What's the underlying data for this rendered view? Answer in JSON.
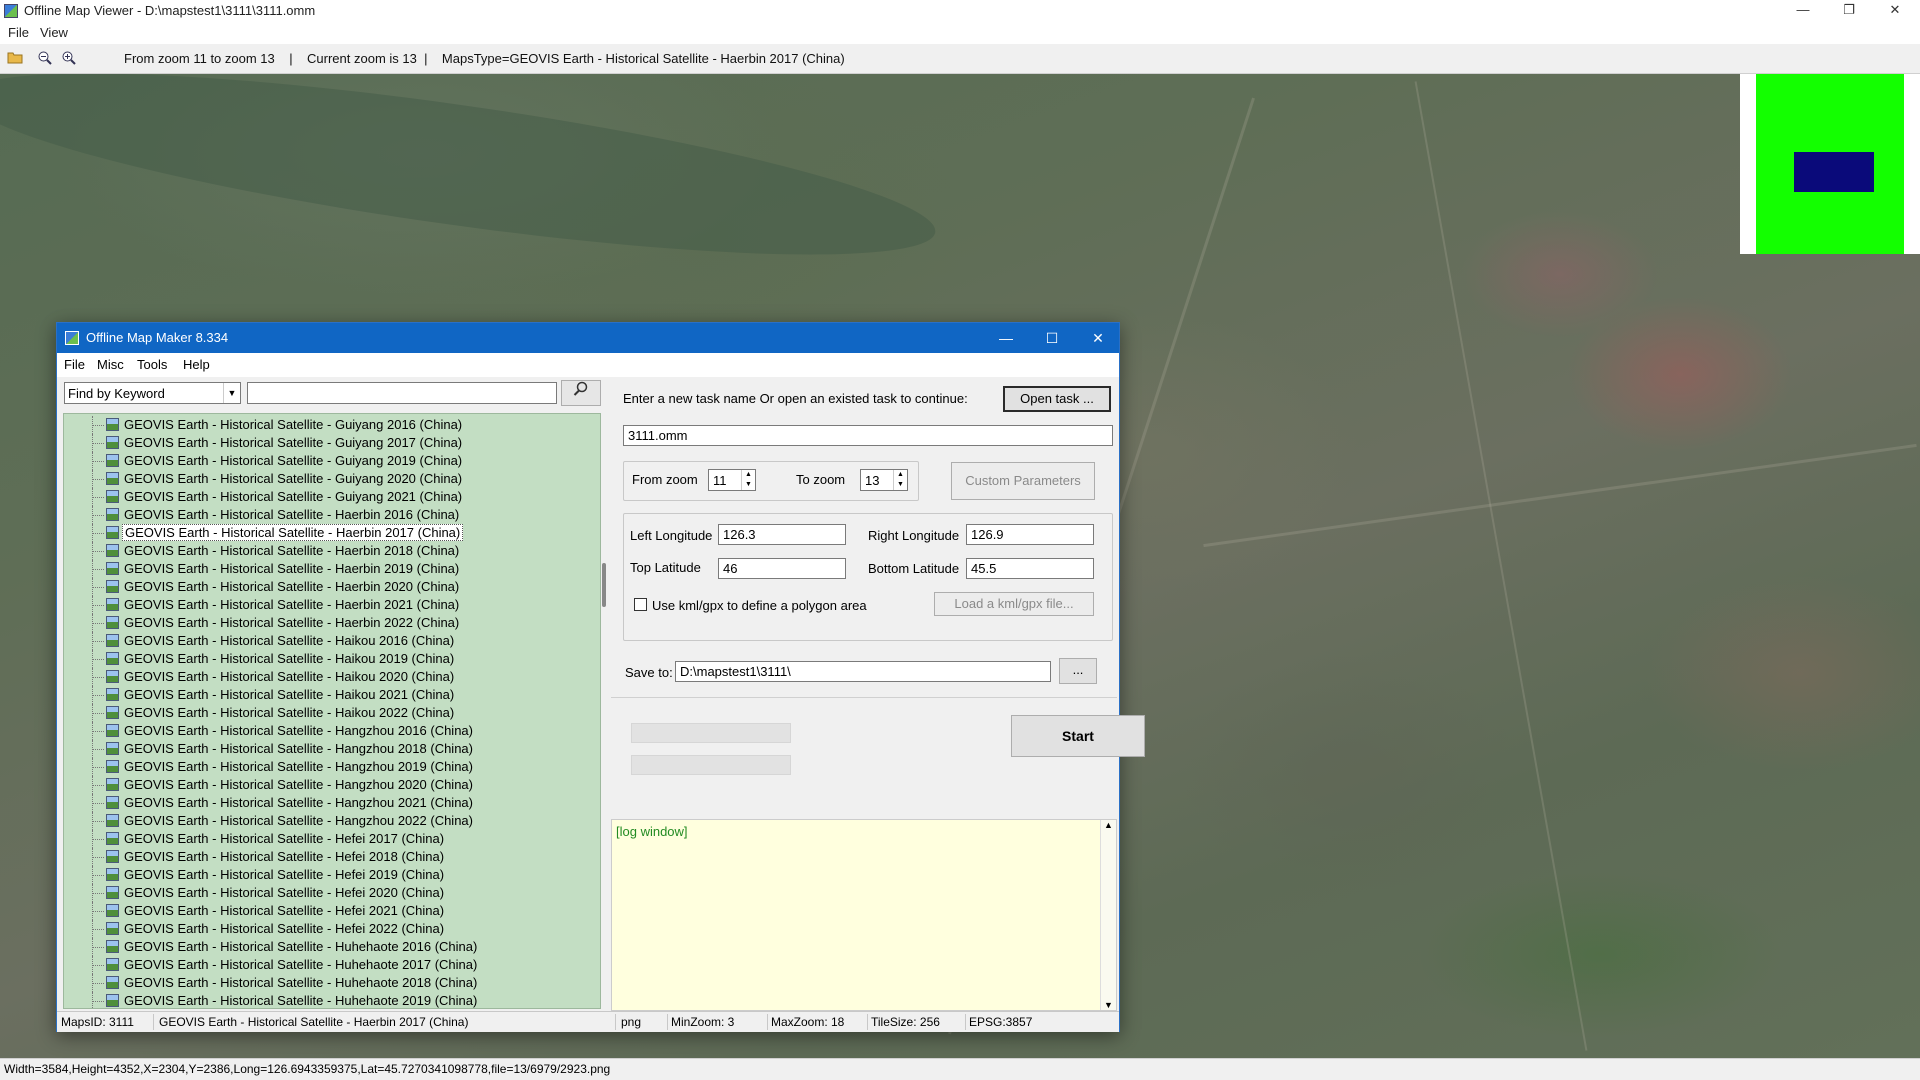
{
  "viewer": {
    "title": "Offline Map Viewer - D:\\mapstest1\\3111\\3111.omm",
    "window_buttons": [
      "—",
      "❐",
      "✕"
    ],
    "menu": [
      "File",
      "View"
    ],
    "toolbar_info": "From zoom 11 to zoom 13    |    Current zoom is 13  |    MapsType=GEOVIS Earth - Historical Satellite - Haerbin 2017 (China)",
    "status": "Width=3584,Height=4352,X=2304,Y=2386,Long=126.6943359375,Lat=45.7270341098778,file=13/6979/2923.png",
    "colors": {
      "overview_bg": "#13ff00",
      "overview_view": "#0a0a7a"
    }
  },
  "maker": {
    "title": "Offline Map Maker 8.334",
    "window_buttons": [
      "—",
      "☐",
      "✕"
    ],
    "menu": [
      "File",
      "Misc",
      "Tools",
      "Help"
    ],
    "find_mode": "Find by Keyword",
    "find_value": "",
    "tree_items": [
      "GEOVIS Earth - Historical Satellite - Guiyang 2016 (China)",
      "GEOVIS Earth - Historical Satellite - Guiyang 2017 (China)",
      "GEOVIS Earth - Historical Satellite - Guiyang 2019 (China)",
      "GEOVIS Earth - Historical Satellite - Guiyang 2020 (China)",
      "GEOVIS Earth - Historical Satellite - Guiyang 2021 (China)",
      "GEOVIS Earth - Historical Satellite - Haerbin 2016 (China)",
      "GEOVIS Earth - Historical Satellite - Haerbin 2017 (China)",
      "GEOVIS Earth - Historical Satellite - Haerbin 2018 (China)",
      "GEOVIS Earth - Historical Satellite - Haerbin 2019 (China)",
      "GEOVIS Earth - Historical Satellite - Haerbin 2020 (China)",
      "GEOVIS Earth - Historical Satellite - Haerbin 2021 (China)",
      "GEOVIS Earth - Historical Satellite - Haerbin 2022 (China)",
      "GEOVIS Earth - Historical Satellite - Haikou 2016 (China)",
      "GEOVIS Earth - Historical Satellite - Haikou 2019 (China)",
      "GEOVIS Earth - Historical Satellite - Haikou 2020 (China)",
      "GEOVIS Earth - Historical Satellite - Haikou 2021 (China)",
      "GEOVIS Earth - Historical Satellite - Haikou 2022 (China)",
      "GEOVIS Earth - Historical Satellite - Hangzhou 2016 (China)",
      "GEOVIS Earth - Historical Satellite - Hangzhou 2018 (China)",
      "GEOVIS Earth - Historical Satellite - Hangzhou 2019 (China)",
      "GEOVIS Earth - Historical Satellite - Hangzhou 2020 (China)",
      "GEOVIS Earth - Historical Satellite - Hangzhou 2021 (China)",
      "GEOVIS Earth - Historical Satellite - Hangzhou 2022 (China)",
      "GEOVIS Earth - Historical Satellite - Hefei 2017 (China)",
      "GEOVIS Earth - Historical Satellite - Hefei 2018 (China)",
      "GEOVIS Earth - Historical Satellite - Hefei 2019 (China)",
      "GEOVIS Earth - Historical Satellite - Hefei 2020 (China)",
      "GEOVIS Earth - Historical Satellite - Hefei 2021 (China)",
      "GEOVIS Earth - Historical Satellite - Hefei 2022 (China)",
      "GEOVIS Earth - Historical Satellite - Huhehaote 2016 (China)",
      "GEOVIS Earth - Historical Satellite - Huhehaote 2017 (China)",
      "GEOVIS Earth - Historical Satellite - Huhehaote 2018 (China)",
      "GEOVIS Earth - Historical Satellite - Huhehaote 2019 (China)"
    ],
    "selected_item": "GEOVIS Earth - Historical Satellite - Haerbin 2017 (China)",
    "task_prompt": "Enter a new task name Or open an existed task to continue:",
    "open_task_label": "Open task ...",
    "task_name": "3111.omm",
    "from_zoom_label": "From zoom",
    "from_zoom": "11",
    "to_zoom_label": "To zoom",
    "to_zoom": "13",
    "custom_params_label": "Custom Parameters",
    "left_lon_label": "Left Longitude",
    "left_lon": "126.3",
    "right_lon_label": "Right Longitude",
    "right_lon": "126.9",
    "top_lat_label": "Top Latitude",
    "top_lat": "46",
    "bottom_lat_label": "Bottom Latitude",
    "bottom_lat": "45.5",
    "kml_label": "Use kml/gpx to define a polygon area",
    "load_kml_label": "Load a kml/gpx file...",
    "save_to_label": "Save to:",
    "save_to": "D:\\mapstest1\\3111\\",
    "browse_label": "...",
    "start_label": "Start",
    "log_text": "[log window]",
    "status": {
      "maps_id": "MapsID: 3111",
      "maps_name": "GEOVIS Earth - Historical Satellite - Haerbin 2017 (China)",
      "format": "png",
      "min_zoom": "MinZoom: 3",
      "max_zoom": "MaxZoom: 18",
      "tile_size": "TileSize: 256",
      "epsg": "EPSG:3857"
    }
  }
}
